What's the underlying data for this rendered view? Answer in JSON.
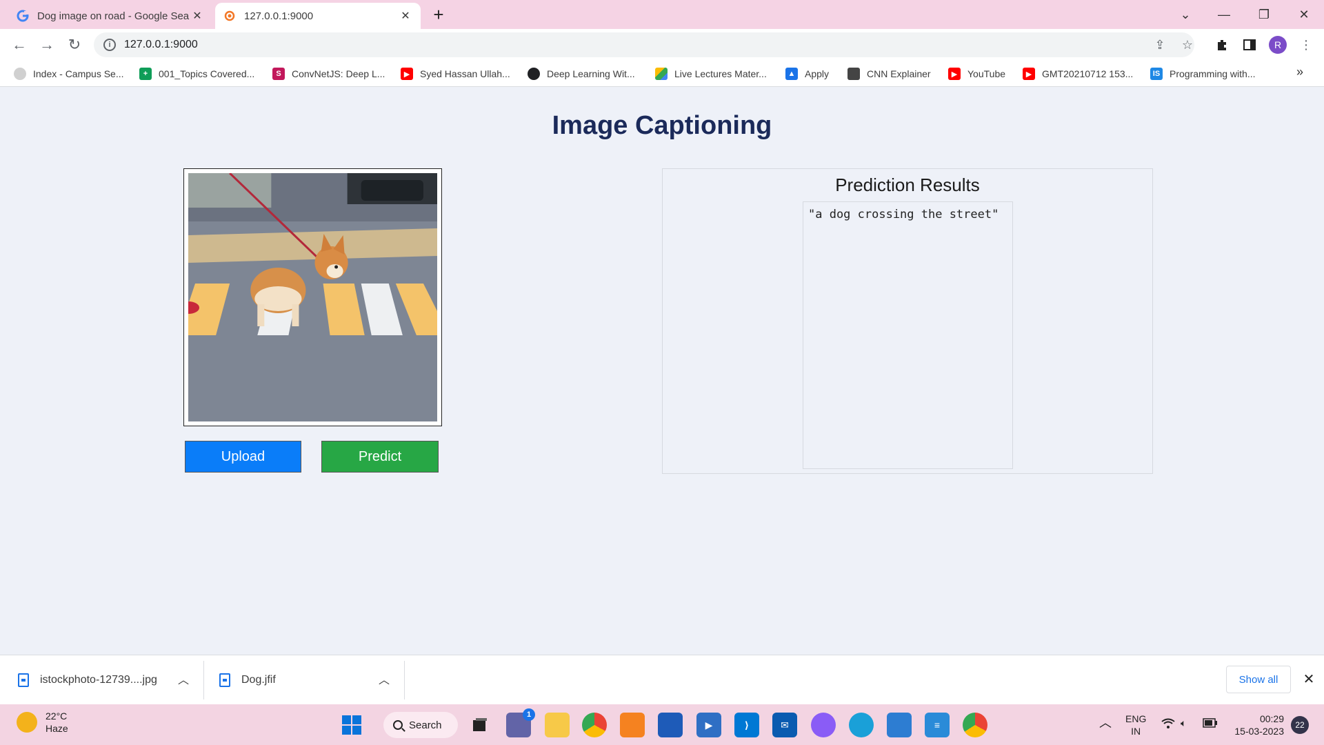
{
  "browser": {
    "tabs": [
      {
        "title": "Dog image on road - Google Sea",
        "active": false
      },
      {
        "title": "127.0.0.1:9000",
        "active": true
      }
    ],
    "new_tab": "+",
    "address": "127.0.0.1:9000",
    "profile_initial": "R",
    "bookmarks": [
      {
        "label": "Index - Campus Se...",
        "icon_color": "#9aa0a6"
      },
      {
        "label": "001_Topics Covered...",
        "icon_color": "#0f9d58"
      },
      {
        "label": "ConvNetJS: Deep L...",
        "icon_color": "#c2185b"
      },
      {
        "label": "Syed Hassan Ullah...",
        "icon_color": "#ff0000"
      },
      {
        "label": "Deep Learning Wit...",
        "icon_color": "#202124"
      },
      {
        "label": "Live Lectures Mater...",
        "icon_color": "#fbbc04"
      },
      {
        "label": "Apply",
        "icon_color": "#1a73e8"
      },
      {
        "label": "CNN Explainer",
        "icon_color": "#444444"
      },
      {
        "label": "YouTube",
        "icon_color": "#ff0000"
      },
      {
        "label": "GMT20210712 153...",
        "icon_color": "#ff0000"
      },
      {
        "label": "Programming with...",
        "icon_color": "#1e88e5"
      }
    ],
    "bookmarks_more": "»"
  },
  "page": {
    "title": "Image Captioning",
    "upload_label": "Upload",
    "predict_label": "Predict",
    "results_title": "Prediction Results",
    "caption": "\"a dog crossing the street\"",
    "colors": {
      "title": "#1b2a5a",
      "upload": "#0a7df9",
      "predict": "#27a745",
      "background": "#eef1f8"
    }
  },
  "downloads": {
    "items": [
      {
        "name": "istockphoto-12739....jpg"
      },
      {
        "name": "Dog.jfif"
      }
    ],
    "show_all": "Show all"
  },
  "taskbar": {
    "weather_temp": "22°C",
    "weather_desc": "Haze",
    "search_label": "Search",
    "teams_badge": "1",
    "language_top": "ENG",
    "language_bottom": "IN",
    "time": "00:29",
    "date": "15-03-2023",
    "notifications": "22"
  }
}
